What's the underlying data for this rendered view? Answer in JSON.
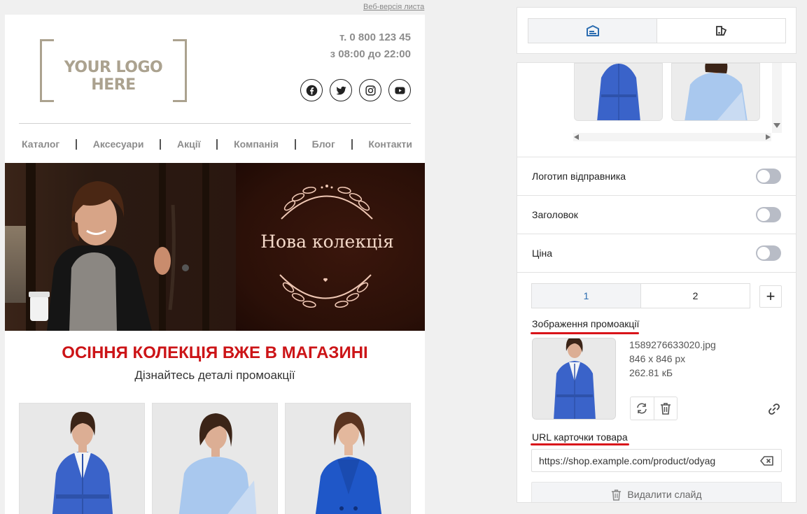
{
  "email": {
    "web_version_link": "Веб-версія листа",
    "logo_text": "YOUR LOGO HERE",
    "phone": "т. 0 800 123 45",
    "hours": "з 08:00 до 22:00",
    "socials": [
      "facebook-icon",
      "twitter-icon",
      "instagram-icon",
      "youtube-icon"
    ],
    "nav": [
      "Каталог",
      "Аксесуари",
      "Акції",
      "Компанія",
      "Блог",
      "Контакти"
    ],
    "banner_title": "Нова колекція",
    "promo_heading": "ОСІННЯ КОЛЕКЦІЯ ВЖЕ В МАГАЗИНІ",
    "promo_subheading": "Дізнайтесь деталі промоакції",
    "colors": {
      "accent_red": "#cc1417",
      "banner_bg": "#2b1108",
      "coat_blue": "#3a63c9",
      "sweater_blue": "#a9c8ee"
    }
  },
  "panel": {
    "tabs": [
      {
        "icon": "content-settings-icon",
        "active": true
      },
      {
        "icon": "style-settings-icon",
        "active": false
      }
    ],
    "toggles": [
      {
        "label": "Логотип відправника",
        "on": false
      },
      {
        "label": "Заголовок",
        "on": false
      },
      {
        "label": "Ціна",
        "on": false
      }
    ],
    "slides": [
      "1",
      "2"
    ],
    "add_slide_label": "+",
    "image_section_label": "Зображення промоакції",
    "image": {
      "filename": "1589276633020.jpg",
      "dimensions": "846 х 846 px",
      "size": "262.81 кБ"
    },
    "url_label": "URL карточки товара",
    "url_value": "https://shop.example.com/product/odyag",
    "delete_slide_label": "Видалити слайд"
  }
}
